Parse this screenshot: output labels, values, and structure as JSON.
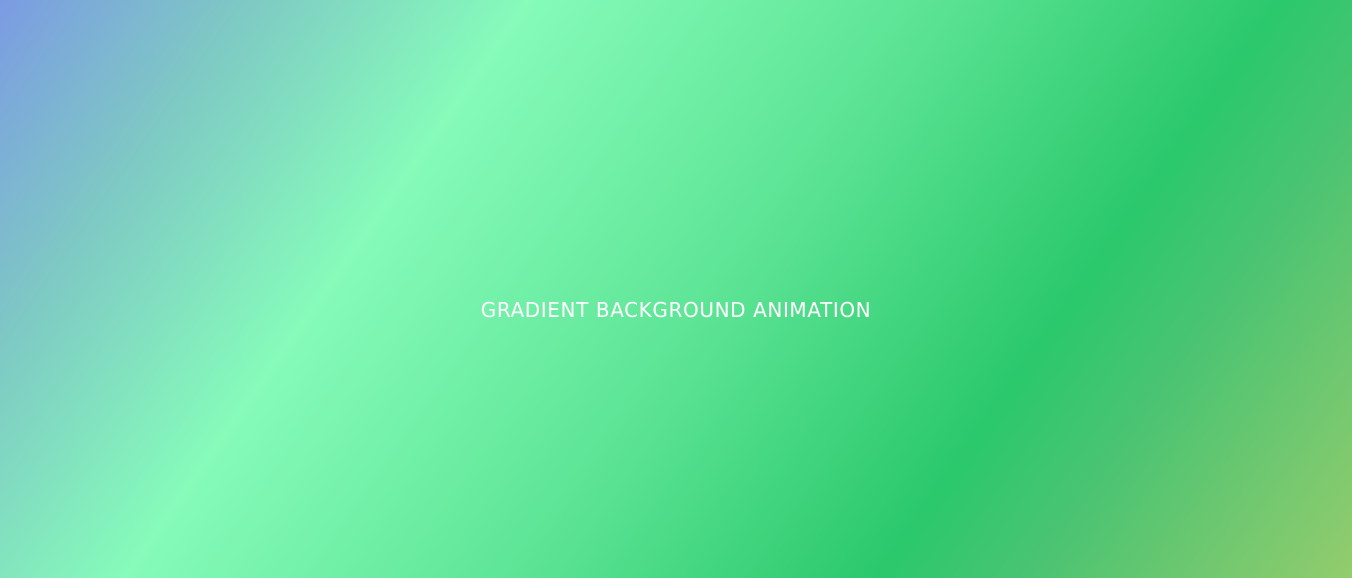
{
  "page": {
    "title": "GRADIENT BACKGROUND ANIMATION"
  },
  "colors": {
    "gradient_start": "#7b9be3",
    "gradient_mid_light": "#86fbba",
    "gradient_mid_dark": "#2bc86c",
    "gradient_end": "#93cc6d",
    "text": "#ffffff"
  }
}
